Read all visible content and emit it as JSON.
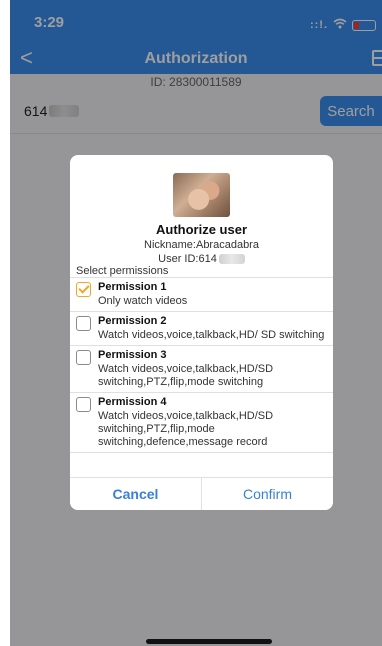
{
  "status_bar": {
    "time": "3:29",
    "signal": "::!."
  },
  "nav": {
    "back_glyph": "<",
    "title": "Authorization"
  },
  "device": {
    "id_text": "ID: 28300011589"
  },
  "search": {
    "value_prefix": "614",
    "button_label": "Search"
  },
  "modal": {
    "title": "Authorize user",
    "nickname": "Nickname:Abracadabra",
    "user_id_prefix": "User ID:614",
    "select_label": "Select permissions",
    "permissions": [
      {
        "name": "Permission 1",
        "desc": "Only watch videos",
        "checked": true
      },
      {
        "name": "Permission 2",
        "desc": "Watch videos,voice,talkback,HD/ SD switching",
        "checked": false
      },
      {
        "name": "Permission 3",
        "desc": "Watch videos,voice,talkback,HD/SD switching,PTZ,flip,mode switching",
        "checked": false
      },
      {
        "name": "Permission 4",
        "desc": "Watch videos,voice,talkback,HD/SD switching,PTZ,flip,mode switching,defence,message record",
        "checked": false
      }
    ],
    "cancel_label": "Cancel",
    "confirm_label": "Confirm"
  },
  "colors": {
    "accent": "#3a8ef0",
    "check": "#f5a623",
    "footer_text": "#3a7fd6"
  }
}
